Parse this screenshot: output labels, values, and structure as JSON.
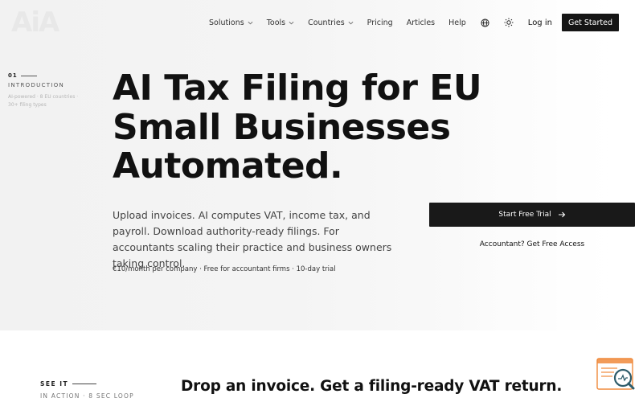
{
  "brand": {
    "logo_text": "AiA"
  },
  "nav": {
    "items": [
      {
        "label": "Solutions",
        "dropdown": true
      },
      {
        "label": "Tools",
        "dropdown": true
      },
      {
        "label": "Countries",
        "dropdown": true
      },
      {
        "label": "Pricing",
        "dropdown": false
      },
      {
        "label": "Articles",
        "dropdown": false
      },
      {
        "label": "Help",
        "dropdown": false
      }
    ],
    "icons": [
      "globe-icon",
      "sun-icon"
    ],
    "login_label": "Log in",
    "cta_label": "Get Started"
  },
  "intro": {
    "number": "01",
    "title": "INTRODUCTION",
    "note": "AI-powered · 8 EU countries · 30+ filing types"
  },
  "hero": {
    "headline": "AI Tax Filing for EU Small Businesses Automated.",
    "subtext": "Upload invoices. AI computes VAT, income tax, and payroll. Download authority-ready filings. For accountants scaling their practice and business owners taking control.",
    "meta": "€10/month per company · Free for accountant firms · 10-day trial",
    "primary_cta": "Start Free Trial",
    "secondary_cta": "Accountant? Get Free Access"
  },
  "demo": {
    "label": "SEE IT",
    "sublabel": "IN ACTION · 8 SEC LOOP",
    "title": "Drop an invoice. Get a filing-ready VAT return."
  },
  "colors": {
    "primary_dark": "#151515",
    "hero_bg": "#f3f3f3",
    "widget_accent": "#f08a3c",
    "widget_icon": "#2f5d6b"
  }
}
